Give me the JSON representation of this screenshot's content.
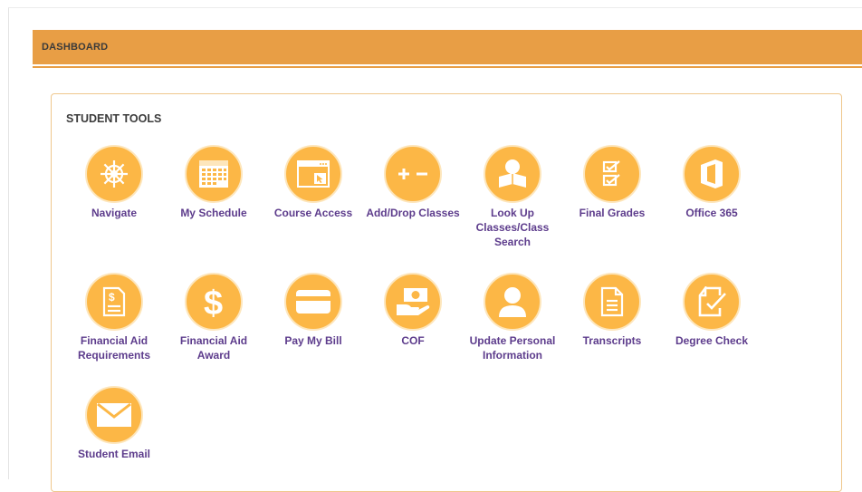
{
  "header": {
    "title": "DASHBOARD"
  },
  "student_tools": {
    "title": "STUDENT TOOLS",
    "items": [
      {
        "label": "Navigate",
        "icon": "ships-wheel-icon"
      },
      {
        "label": "My Schedule",
        "icon": "calendar-icon"
      },
      {
        "label": "Course Access",
        "icon": "browser-window-icon"
      },
      {
        "label": "Add/Drop Classes",
        "icon": "plus-minus-icon"
      },
      {
        "label": "Look Up Classes/Class Search",
        "icon": "reader-icon"
      },
      {
        "label": "Final Grades",
        "icon": "checklist-icon"
      },
      {
        "label": "Office 365",
        "icon": "office-logo-icon"
      },
      {
        "label": "Financial Aid Requirements",
        "icon": "dollar-document-icon"
      },
      {
        "label": "Financial Aid Award",
        "icon": "dollar-sign-icon"
      },
      {
        "label": "Pay My Bill",
        "icon": "credit-card-icon"
      },
      {
        "label": "COF",
        "icon": "money-hand-icon"
      },
      {
        "label": "Update Personal Information",
        "icon": "user-icon"
      },
      {
        "label": "Transcripts",
        "icon": "document-icon"
      },
      {
        "label": "Degree Check",
        "icon": "document-check-icon"
      },
      {
        "label": "Student Email",
        "icon": "envelope-icon"
      }
    ]
  },
  "colors": {
    "accent": "#e89e45",
    "icon_bg": "#fcb746",
    "label": "#5d3c8c"
  }
}
